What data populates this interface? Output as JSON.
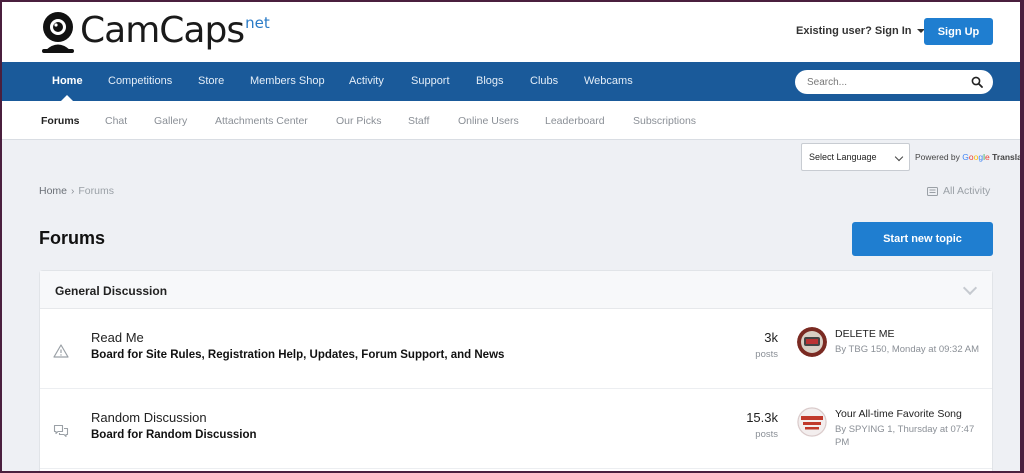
{
  "header": {
    "logo_text": "CamCaps",
    "logo_suffix": "net",
    "signin_label": "Existing user? Sign In",
    "signup_label": "Sign Up"
  },
  "mainnav": {
    "items": [
      "Home",
      "Competitions",
      "Store",
      "Members Shop",
      "Activity",
      "Support",
      "Blogs",
      "Clubs",
      "Webcams"
    ],
    "active": "Home",
    "search_placeholder": "Search..."
  },
  "subnav": {
    "items": [
      "Forums",
      "Chat",
      "Gallery",
      "Attachments Center",
      "Our Picks",
      "Staff",
      "Online Users",
      "Leaderboard",
      "Subscriptions"
    ],
    "active": "Forums"
  },
  "language": {
    "select_label": "Select Language",
    "powered_prefix": "Powered by",
    "powered_brand": "Google",
    "powered_suffix": "Transla"
  },
  "breadcrumb": {
    "home": "Home",
    "current": "Forums",
    "all_activity": "All Activity"
  },
  "page": {
    "title": "Forums",
    "start_topic_label": "Start new topic"
  },
  "section": {
    "title": "General Discussion",
    "forums": [
      {
        "title": "Read Me",
        "description": "Board for Site Rules, Registration Help, Updates, Forum Support, and News",
        "count": "3k",
        "count_label": "posts",
        "last_title": "DELETE ME",
        "last_meta": "By TBG 150, Monday at 09:32 AM",
        "icon": "warning-icon"
      },
      {
        "title": "Random Discussion",
        "description": "Board for Random Discussion",
        "count": "15.3k",
        "count_label": "posts",
        "last_title": "Your All-time Favorite Song",
        "last_meta": "By SPYING 1, Thursday at 07:47 PM",
        "icon": "chat-bubbles-icon"
      }
    ]
  },
  "colors": {
    "nav_bg": "#1a5a9a",
    "button_blue": "#1f7ed0",
    "page_bg": "#eef0f4",
    "frame": "#4a1f3e"
  }
}
